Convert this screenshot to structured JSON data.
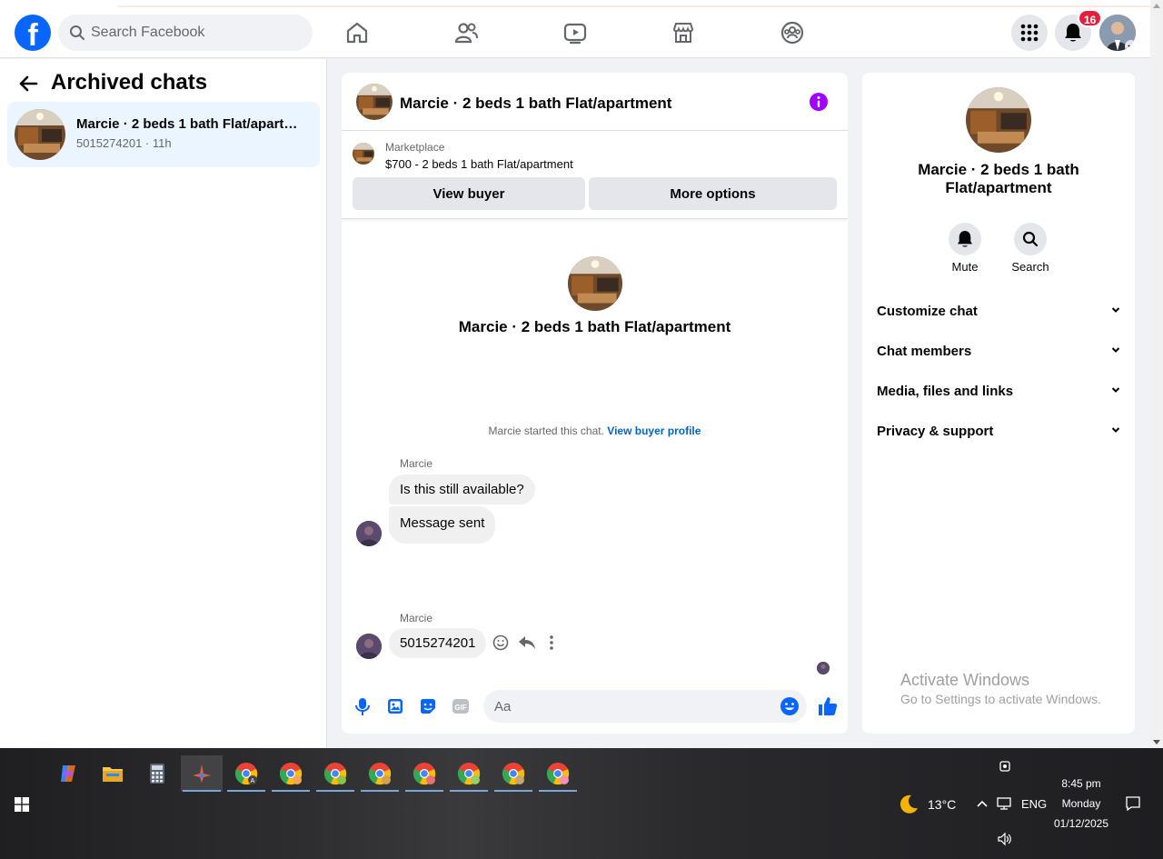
{
  "header": {
    "search_placeholder": "Search Facebook",
    "notifications_count": "16"
  },
  "left": {
    "title": "Archived chats",
    "chat": {
      "name": "Marcie · 2 beds 1 bath Flat/apartment",
      "meta": "5015274201 · 11h"
    }
  },
  "conversation": {
    "title": "Marcie · 2 beds 1 bath Flat/apartment",
    "marketplace_label": "Marketplace",
    "listing": "$700 - 2 beds 1 bath Flat/apartment",
    "view_buyer": "View buyer",
    "more_options": "More options",
    "intro_name": "Marcie · 2 beds 1 bath Flat/apartment",
    "started_text": "Marcie started this chat.",
    "view_buyer_profile": "View buyer profile",
    "messages": [
      {
        "sender": "Marcie",
        "text": "Is this still available?"
      },
      {
        "text": "Message sent"
      },
      {
        "sender": "Marcie",
        "text": "5015274201"
      }
    ],
    "composer_placeholder": "Aa"
  },
  "right": {
    "name": "Marcie · 2 beds 1 bath Flat/apartment",
    "mute": "Mute",
    "search": "Search",
    "sections": [
      "Customize chat",
      "Chat members",
      "Media, files and links",
      "Privacy & support"
    ]
  },
  "watermark": {
    "line1": "Activate Windows",
    "line2": "Go to Settings to activate Windows."
  },
  "taskbar": {
    "weather": "13°C",
    "language": "ENG",
    "time": "8:45 pm",
    "day": "Monday",
    "date": "01/12/2025"
  },
  "colors": {
    "brand": "#0866ff",
    "accent_purple": "#a200ff",
    "badge": "#e41e3f"
  }
}
